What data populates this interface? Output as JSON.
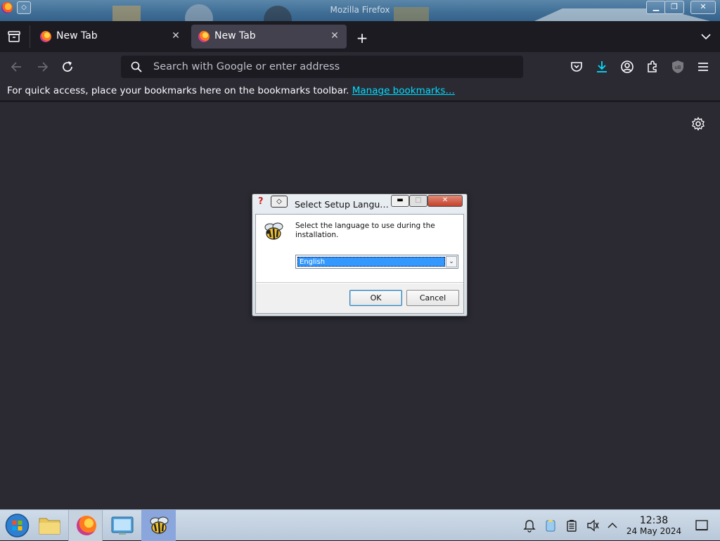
{
  "window": {
    "title": "Mozilla Firefox"
  },
  "tabs": [
    {
      "label": "New Tab",
      "active": false
    },
    {
      "label": "New Tab",
      "active": true
    }
  ],
  "urlbar": {
    "placeholder": "Search with Google or enter address"
  },
  "bookmarks_toolbar": {
    "message": "For quick access, place your bookmarks here on the bookmarks toolbar.",
    "link": "Manage bookmarks…"
  },
  "dialog": {
    "title": "Select Setup Langu…",
    "message": "Select the language to use during the installation.",
    "selected_language": "English",
    "ok_label": "OK",
    "cancel_label": "Cancel"
  },
  "taskbar": {
    "clock_time": "12:38",
    "clock_date": "24 May 2024"
  },
  "colors": {
    "accent": "#00ddff",
    "selection": "#3399ff",
    "browser_bg": "#2b2a33",
    "tabstrip_bg": "#1c1b22"
  },
  "icons": [
    "firefox-icon",
    "pin-icon",
    "minimize-icon",
    "restore-icon",
    "close-icon",
    "tab-list-icon",
    "plus-icon",
    "chevron-down-icon",
    "back-arrow-icon",
    "forward-arrow-icon",
    "reload-icon",
    "search-icon",
    "pocket-icon",
    "download-icon",
    "account-icon",
    "extensions-icon",
    "ublock-icon",
    "menu-icon",
    "gear-icon",
    "bee-icon",
    "start-orb-icon",
    "file-manager-icon",
    "system-settings-icon",
    "notifications-icon",
    "clipboard-icon",
    "battery-icon",
    "mute-icon",
    "chevron-up-icon",
    "show-desktop-icon"
  ]
}
